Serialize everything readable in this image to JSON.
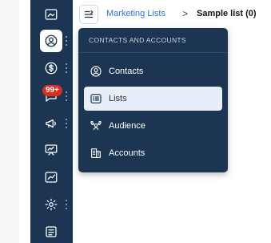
{
  "colors": {
    "rail": "#1b3552",
    "accent": "#2f6fd6",
    "badge": "#d92d20",
    "active_item_bg": "#e7eef8"
  },
  "rail": {
    "items": [
      {
        "icon": "image-frame-icon"
      },
      {
        "icon": "user-circle-icon",
        "active": true
      },
      {
        "icon": "dollar-circle-icon"
      },
      {
        "icon": "chat-icon",
        "badge": "99+"
      },
      {
        "icon": "megaphone-icon"
      },
      {
        "icon": "presentation-icon"
      },
      {
        "icon": "trend-chart-icon"
      },
      {
        "icon": "gear-icon"
      },
      {
        "icon": "list-doc-icon"
      }
    ]
  },
  "chat_badge": "99+",
  "breadcrumb": {
    "parent": "Marketing Lists",
    "separator": ">",
    "current": "Sample list (0)"
  },
  "dropdown": {
    "title": "CONTACTS AND ACCOUNTS",
    "items": [
      {
        "label": "Contacts",
        "icon": "user-circle-icon"
      },
      {
        "label": "Lists",
        "icon": "list-icon",
        "active": true
      },
      {
        "label": "Audience",
        "icon": "audience-icon"
      },
      {
        "label": "Accounts",
        "icon": "building-icon"
      }
    ]
  }
}
